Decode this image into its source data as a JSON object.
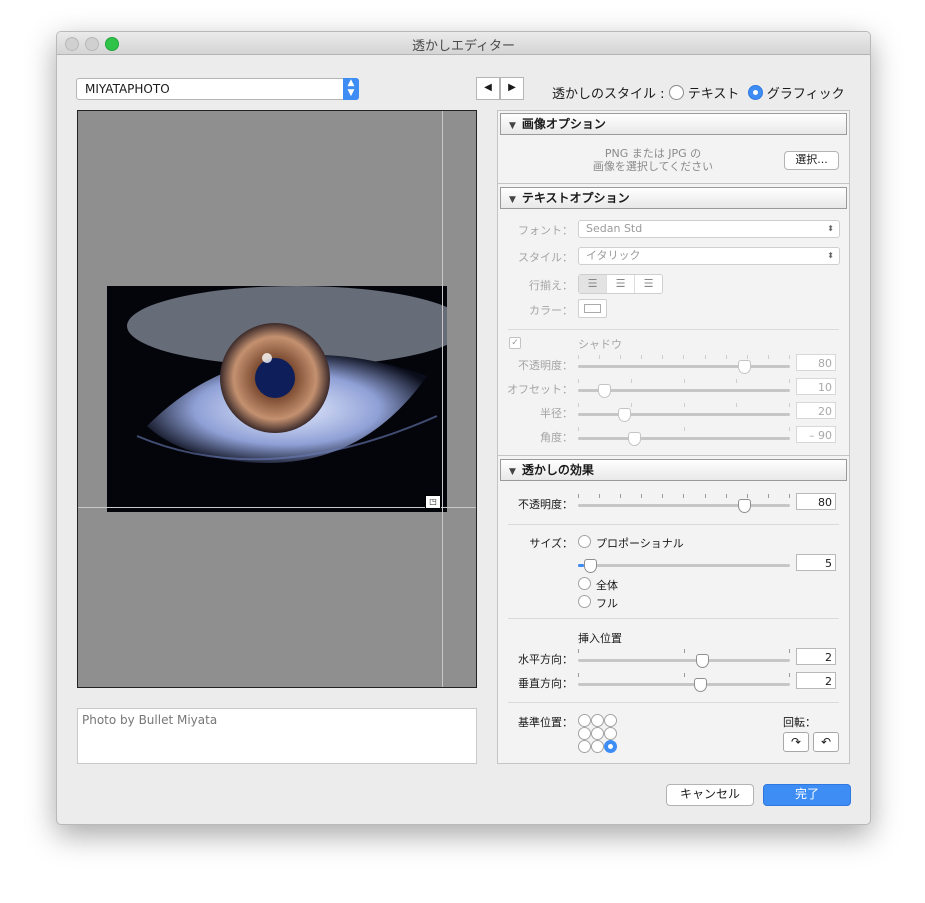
{
  "window": {
    "title": "透かしエディター"
  },
  "preset": {
    "value": "MIYATAPHOTO"
  },
  "nav": {
    "prev": "◀",
    "next": "▶"
  },
  "style": {
    "label": "透かしのスタイル :",
    "text_option": "テキスト",
    "graphic_option": "グラフィック",
    "selected": "グラフィック"
  },
  "preview": {
    "caption": "Photo by Bullet Miyata"
  },
  "image_options": {
    "header": "画像オプション",
    "hint_line1": "PNG または JPG の",
    "hint_line2": "画像を選択してください",
    "choose_button": "選択..."
  },
  "text_options": {
    "header": "テキストオプション",
    "font_label": "フォント：",
    "font_value": "Sedan Std",
    "style_label": "スタイル：",
    "style_value": "イタリック",
    "align_label": "行揃え：",
    "color_label": "カラー：",
    "shadow_label": "シャドウ",
    "shadow_opacity_label": "不透明度：",
    "shadow_opacity": "80",
    "offset_label": "オフセット：",
    "offset": "10",
    "radius_label": "半径：",
    "radius": "20",
    "angle_label": "角度：",
    "angle": "– 90"
  },
  "watermark_effects": {
    "header": "透かしの効果",
    "opacity_label": "不透明度：",
    "opacity": "80",
    "size_label": "サイズ：",
    "size_proportional": "プロポーショナル",
    "size_value": "5",
    "size_fit": "全体",
    "size_fill": "フル",
    "inset_label": "挿入位置",
    "horizontal_label": "水平方向：",
    "horizontal": "2",
    "vertical_label": "垂直方向：",
    "vertical": "2",
    "anchor_label": "基準位置：",
    "rotate_label": "回転："
  },
  "buttons": {
    "cancel": "キャンセル",
    "done": "完了"
  },
  "colors": {
    "accent": "#3d8df5",
    "close": "#d0d0d0",
    "zoom": "#2fc34a"
  },
  "icons": {
    "rotate_cw": "↷",
    "rotate_ccw": "↶"
  }
}
